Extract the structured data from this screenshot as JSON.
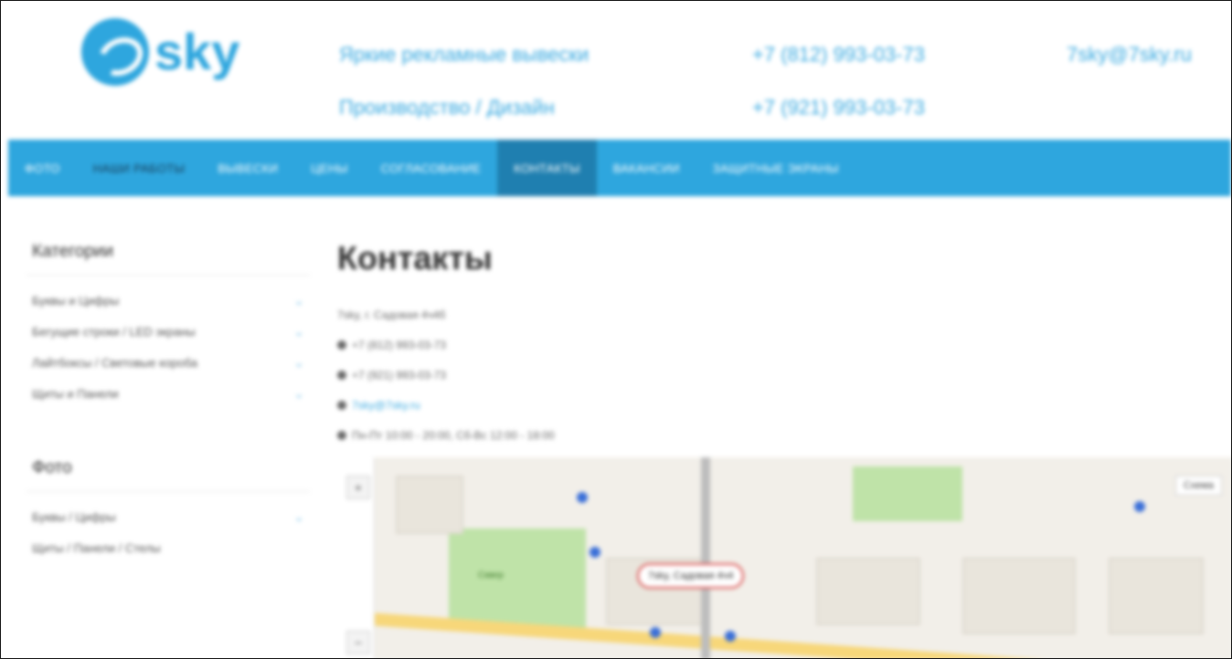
{
  "header": {
    "logo_text": "sky",
    "tagline": [
      "Яркие рекламные вывески",
      "Производство / Дизайн"
    ],
    "phones": [
      "+7 (812) 993-03-73",
      "+7 (921) 993-03-73"
    ],
    "email": "7sky@7sky.ru"
  },
  "nav": {
    "items": [
      "ФОТО",
      "НАШИ РАБОТЫ",
      "ВЫВЕСКИ",
      "ЦЕНЫ",
      "СОГЛАСОВАНИЕ",
      "КОНТАКТЫ",
      "ВАКАНСИИ",
      "ЗАЩИТНЫЕ ЭКРАНЫ"
    ],
    "active": "КОНТАКТЫ"
  },
  "sidebar": {
    "categories_title": "Категории",
    "categories": [
      "Буквы и Цифры",
      "Бегущие строки / LED экраны",
      "Лайтбоксы / Световые короба",
      "Щиты и Панели"
    ],
    "photo_title": "Фото",
    "photo_items": [
      "Буквы / Цифры",
      "Щиты / Панели / Стелы"
    ]
  },
  "content": {
    "title": "Контакты",
    "address": "7sky, г. Садовая 4ч4б",
    "phone1": "+7 (812) 993-03-73",
    "phone2": "+7 (921) 993-03-73",
    "email": "7sky@7sky.ru",
    "hours": "Пн-Пт 10:00 - 20:00, Сб-Вс 12:00 - 18:00"
  },
  "map": {
    "pin_label": "7sky, Садовая 4ч4",
    "park_label": "Сквер",
    "layers_label": "Схема"
  },
  "colors": {
    "accent": "#2ea6de",
    "nav_active": "#1f7fb0"
  }
}
